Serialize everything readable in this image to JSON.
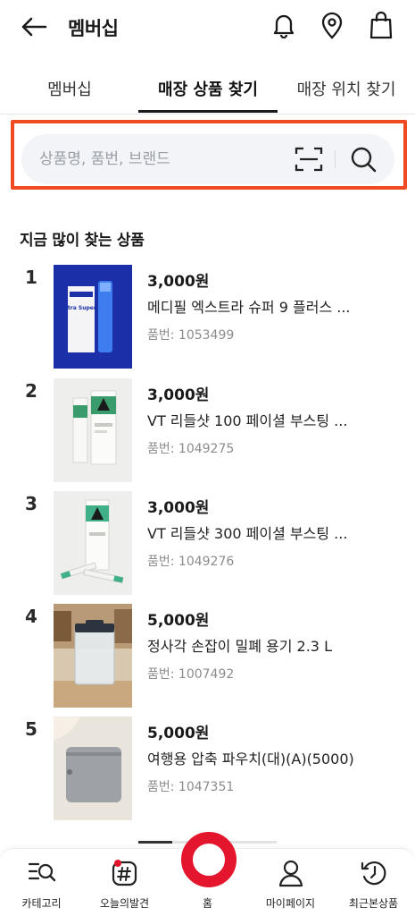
{
  "header": {
    "title": "멤버십",
    "icons": [
      "back-arrow-icon",
      "bell-icon",
      "location-pin-icon",
      "shopping-bag-icon"
    ]
  },
  "tabs": [
    {
      "label": "멤버십",
      "active": false
    },
    {
      "label": "매장 상품 찾기",
      "active": true
    },
    {
      "label": "매장 위치 찾기",
      "active": false
    }
  ],
  "search": {
    "placeholder": "상품명, 품번, 브랜드",
    "value": ""
  },
  "popular": {
    "title": "지금 많이 찾는 상품",
    "items": [
      {
        "rank": "1",
        "price": "3,000원",
        "name": "메디필 엑스트라 슈퍼 9 플러스 ...",
        "code": "품번: 1053499",
        "thumb_text": "Extra Super 9"
      },
      {
        "rank": "2",
        "price": "3,000원",
        "name": "VT 리들샷 100 페이셜 부스팅 ...",
        "code": "품번: 1049275"
      },
      {
        "rank": "3",
        "price": "3,000원",
        "name": "VT 리들샷 300 페이셜 부스팅 ...",
        "code": "품번: 1049276"
      },
      {
        "rank": "4",
        "price": "5,000원",
        "name": "정사각 손잡이 밀폐 용기 2.3 L",
        "code": "품번: 1007492"
      },
      {
        "rank": "5",
        "price": "5,000원",
        "name": "여행용 압축 파우치(대)(A)(5000)",
        "code": "품번: 1047351"
      }
    ]
  },
  "bottom_nav": {
    "items": [
      {
        "label": "카테고리",
        "icon": "category-search-icon"
      },
      {
        "label": "오늘의발견",
        "icon": "hashtag-icon"
      },
      {
        "label": "홈",
        "icon": "home-ring-icon"
      },
      {
        "label": "마이페이지",
        "icon": "person-icon"
      },
      {
        "label": "최근본상품",
        "icon": "history-icon"
      }
    ]
  },
  "colors": {
    "accent_red": "#e3162e",
    "highlight_orange": "#f04a23",
    "search_bg": "#f2f4f7"
  }
}
